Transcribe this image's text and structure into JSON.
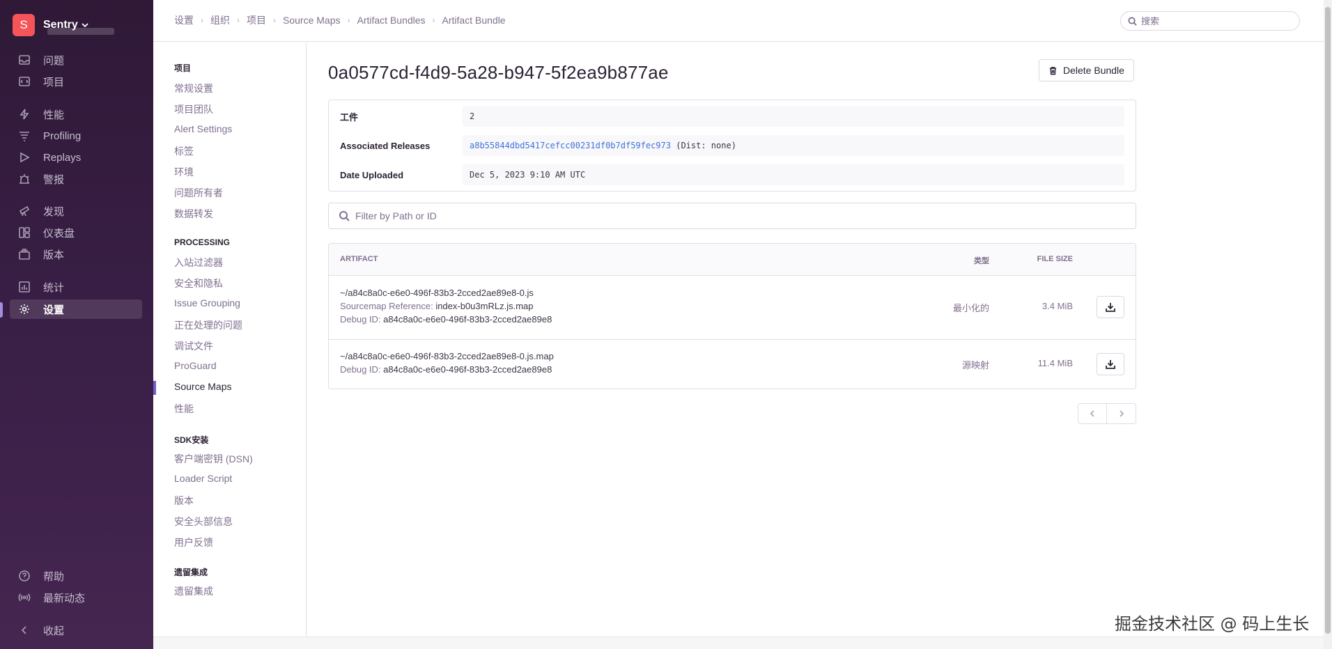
{
  "org": {
    "badge": "S",
    "name": "Sentry"
  },
  "nav": {
    "items": [
      {
        "label": "问题",
        "icon": "inbox-icon"
      },
      {
        "label": "项目",
        "icon": "project-icon"
      },
      {
        "label": "性能",
        "icon": "lightning-icon"
      },
      {
        "label": "Profiling",
        "icon": "profiling-icon"
      },
      {
        "label": "Replays",
        "icon": "play-icon"
      },
      {
        "label": "警报",
        "icon": "siren-icon"
      },
      {
        "label": "发现",
        "icon": "telescope-icon"
      },
      {
        "label": "仪表盘",
        "icon": "dashboard-icon"
      },
      {
        "label": "版本",
        "icon": "releases-icon"
      },
      {
        "label": "统计",
        "icon": "stats-icon"
      },
      {
        "label": "设置",
        "icon": "gear-icon"
      }
    ],
    "bottom": [
      {
        "label": "帮助",
        "icon": "question-icon"
      },
      {
        "label": "最新动态",
        "icon": "broadcast-icon"
      },
      {
        "label": "收起",
        "icon": "chevron-left-icon"
      }
    ]
  },
  "breadcrumbs": [
    "设置",
    "组织",
    "项目",
    "Source Maps",
    "Artifact Bundles",
    "Artifact Bundle"
  ],
  "search": {
    "placeholder": "搜索"
  },
  "subnav": {
    "sections": [
      {
        "title": "项目",
        "items": [
          "常规设置",
          "项目团队",
          "Alert Settings",
          "标签",
          "环境",
          "问题所有者",
          "数据转发"
        ]
      },
      {
        "title": "PROCESSING",
        "items": [
          "入站过滤器",
          "安全和隐私",
          "Issue Grouping",
          "正在处理的问题",
          "调试文件",
          "ProGuard",
          "Source Maps",
          "性能"
        ]
      },
      {
        "title": "SDK安装",
        "items": [
          "客户端密钥 (DSN)",
          "Loader Script",
          "版本",
          "安全头部信息",
          "用户反馈"
        ]
      },
      {
        "title": "遗留集成",
        "items": [
          "遗留集成"
        ]
      }
    ],
    "active": "Source Maps"
  },
  "page": {
    "title": "0a0577cd-f4d9-5a28-b947-5f2ea9b877ae",
    "delete_label": "Delete Bundle"
  },
  "details": {
    "artifacts_key": "工件",
    "artifacts_val": "2",
    "releases_key": "Associated Releases",
    "release_link": "a8b55844dbd5417cefcc00231df0b7df59fec973",
    "release_dist": "(Dist: none)",
    "uploaded_key": "Date Uploaded",
    "uploaded_val": "Dec 5, 2023 9:10 AM UTC"
  },
  "filter": {
    "placeholder": "Filter by Path or ID"
  },
  "table": {
    "headers": {
      "artifact": "ARTIFACT",
      "type": "类型",
      "size": "FILE SIZE"
    },
    "rows": [
      {
        "path": "~/a84c8a0c-e6e0-496f-83b3-2cced2ae89e8-0.js",
        "ref_label": "Sourcemap Reference:",
        "ref_value": "index-b0u3mRLz.js.map",
        "debug_label": "Debug ID:",
        "debug_value": "a84c8a0c-e6e0-496f-83b3-2cced2ae89e8",
        "type": "最小化的",
        "size": "3.4 MiB"
      },
      {
        "path": "~/a84c8a0c-e6e0-496f-83b3-2cced2ae89e8-0.js.map",
        "debug_label": "Debug ID:",
        "debug_value": "a84c8a0c-e6e0-496f-83b3-2cced2ae89e8",
        "type": "源映射",
        "size": "11.4 MiB"
      }
    ]
  },
  "watermark": "掘金技术社区 @ 码上生长",
  "colors": {
    "accent": "#6c5fc7",
    "sidebar": "#3a1f47",
    "org_badge": "#f55459",
    "link": "#3d74db"
  }
}
